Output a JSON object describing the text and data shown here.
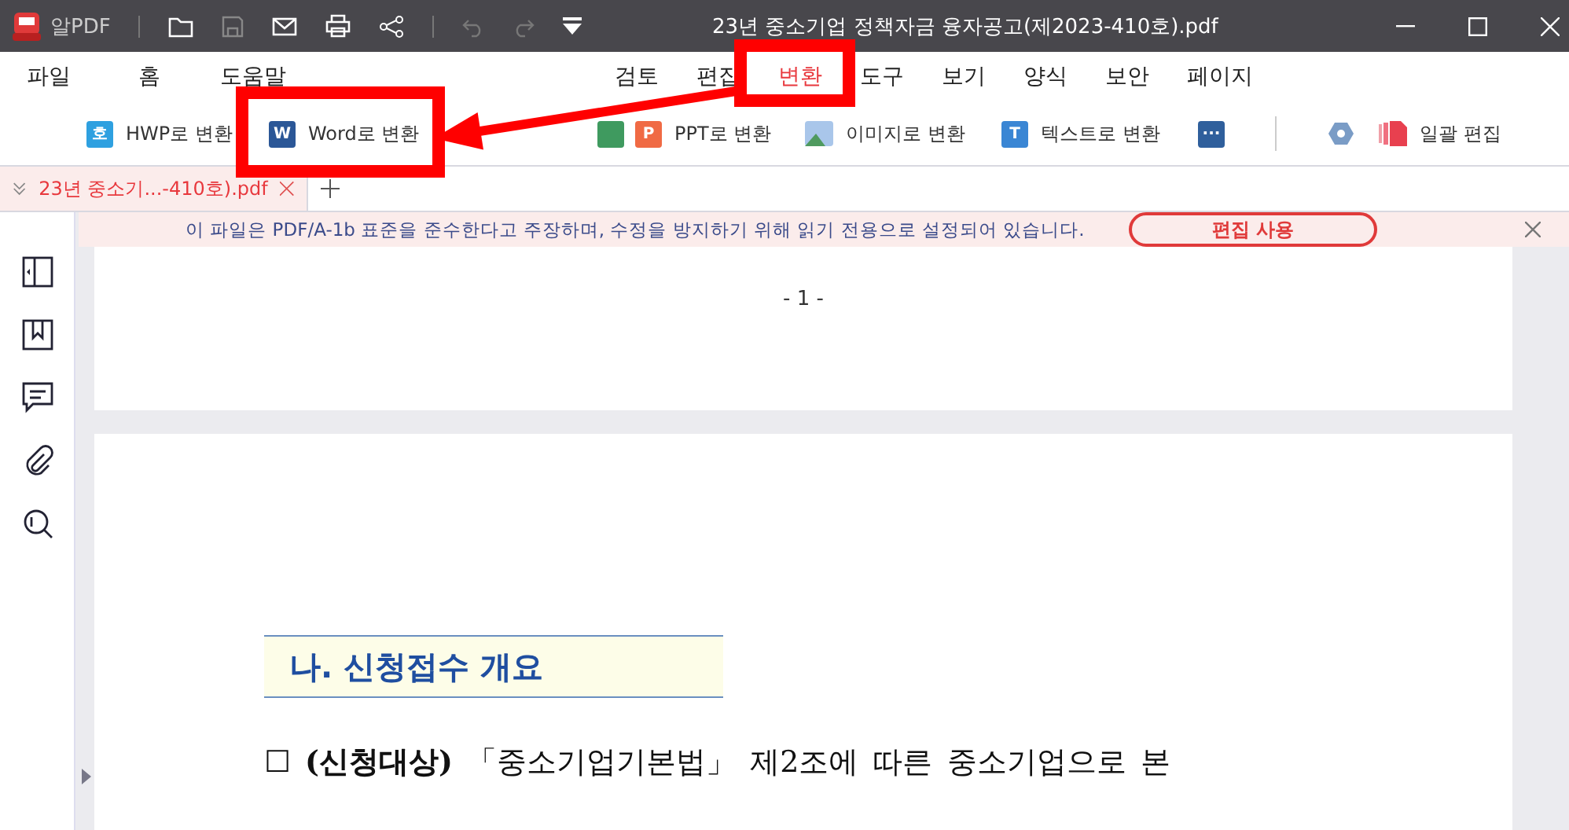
{
  "window": {
    "app_name": "알PDF",
    "title": "23년 중소기업 정책자금 융자공고(제2023-410호).pdf"
  },
  "menu": [
    {
      "label": "파일",
      "selected": false
    },
    {
      "label": "홈",
      "selected": false
    },
    {
      "label": "도움말",
      "selected": false
    },
    {
      "label": "검토",
      "selected": false
    },
    {
      "label": "편집",
      "selected": false
    },
    {
      "label": "변환",
      "selected": true
    },
    {
      "label": "도구",
      "selected": false
    },
    {
      "label": "보기",
      "selected": false
    },
    {
      "label": "양식",
      "selected": false
    },
    {
      "label": "보안",
      "selected": false
    },
    {
      "label": "페이지",
      "selected": false
    }
  ],
  "toolbar": [
    {
      "kind": "hwp",
      "icon": "호",
      "label": "HWP로 변환"
    },
    {
      "kind": "word",
      "icon": "W",
      "label": "Word로 변환"
    },
    {
      "kind": "excel"
    },
    {
      "kind": "ppt",
      "icon": "P",
      "label": "PPT로 변환"
    },
    {
      "kind": "image",
      "label": "이미지로 변환"
    },
    {
      "kind": "text",
      "icon": "T",
      "label": "텍스트로 변환"
    },
    {
      "kind": "more",
      "icon": "···"
    },
    {
      "kind": "hex"
    },
    {
      "kind": "batch",
      "label": "일괄 편집"
    }
  ],
  "tabs": [
    {
      "label": "23년 중소기...-410호).pdf",
      "selected": true
    }
  ],
  "notice": {
    "message": "이 파일은 PDF/A-1b 표준을 준수한다고 주장하며, 수정을 방지하기 위해 읽기 전용으로 설정되어 있습니다.",
    "button": "편집 사용"
  },
  "document": {
    "page_number": "- 1 -",
    "heading": "나. 신청접수 개요",
    "paragraph": "☐ **(신청대상)** 「중소기업기본법」 제2조에 따른 중소기업으로 본"
  }
}
